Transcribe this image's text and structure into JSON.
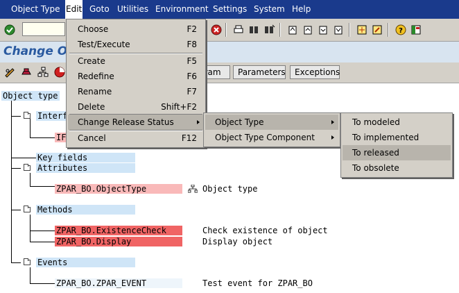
{
  "menubar": {
    "items": [
      "Object Type",
      "Edit",
      "Goto",
      "Utilities",
      "Environment",
      "Settings",
      "System",
      "Help"
    ]
  },
  "title": "Change Ob",
  "app_toolbar": {
    "buttons": [
      "gram",
      "Parameters",
      "Exceptions"
    ]
  },
  "tree": {
    "root": "Object type",
    "interfaces": "Interf",
    "interface_child": "IF",
    "key_fields": "Key fields",
    "attributes": "Attributes",
    "attribute_item": "ZPAR_BO.ObjectType",
    "attribute_desc": "Object type",
    "methods": "Methods",
    "method1": "ZPAR_BO.ExistenceCheck",
    "method1_desc": "Check existence of object",
    "method2": "ZPAR_BO.Display",
    "method2_desc": "Display object",
    "events": "Events",
    "event_item": "ZPAR_BO.ZPAR_EVENT",
    "event_desc": "Test event for ZPAR_BO"
  },
  "edit_menu": {
    "items": [
      {
        "label": "Choose",
        "shortcut": "F2"
      },
      {
        "label": "Test/Execute",
        "shortcut": "F8"
      },
      {
        "label": "Create",
        "shortcut": "F5"
      },
      {
        "label": "Redefine",
        "shortcut": "F6"
      },
      {
        "label": "Rename",
        "shortcut": "F7"
      },
      {
        "label": "Delete",
        "shortcut": "Shift+F2"
      },
      {
        "label": "Change Release Status",
        "shortcut": ""
      },
      {
        "label": "Cancel",
        "shortcut": "F12"
      }
    ]
  },
  "release_menu": {
    "items": [
      "Object Type",
      "Object Type Component"
    ]
  },
  "status_menu": {
    "items": [
      "To modeled",
      "To implemented",
      "To released",
      "To obsolete"
    ]
  },
  "colors": {
    "menubar": "#1a3a8c",
    "title": "#2a5aa0",
    "node_blue": "#cfe5f7",
    "node_red": "#f06464",
    "node_pink": "#f9b9b9"
  }
}
